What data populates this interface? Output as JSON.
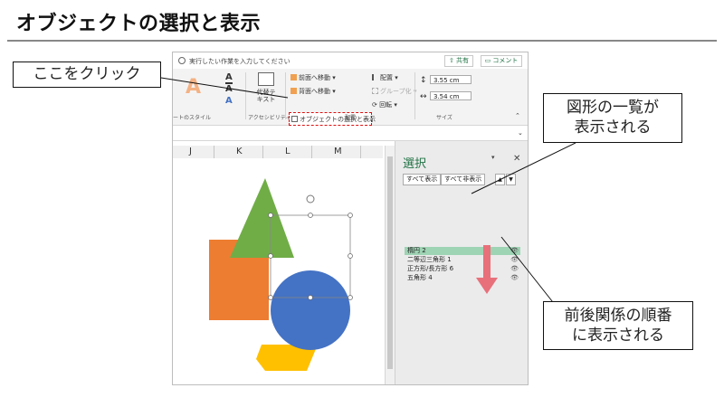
{
  "page": {
    "title": "オブジェクトの選択と表示"
  },
  "excel": {
    "tell_me": "実行したい作業を入力してください",
    "share": "共有",
    "comment": "コメント",
    "ribbon": {
      "wordart_styles_label": "ートのスタイル",
      "alt_text_label": "代替テ キスト",
      "accessibility_label": "アクセシビリティ",
      "arrange_label": "配置",
      "bring_forward": "前面へ移動",
      "send_backward": "背面へ移動",
      "selection_pane": "オブジェクトの選択と表示",
      "align": "配置",
      "group": "グループ化",
      "rotate": "回転",
      "size_label": "サイズ",
      "height": "3.55 cm",
      "width": "3.54 cm"
    },
    "columns": [
      "J",
      "K",
      "L",
      "M"
    ]
  },
  "pane": {
    "title": "選択",
    "show_all": "すべて表示",
    "hide_all": "すべて非表示",
    "objects": [
      {
        "name": "楕円 2",
        "selected": true
      },
      {
        "name": "二等辺三角形 1",
        "selected": false
      },
      {
        "name": "正方形/長方形 6",
        "selected": false
      },
      {
        "name": "五角形 4",
        "selected": false
      }
    ]
  },
  "callouts": {
    "click_here": "ここをクリック",
    "list_line1": "図形の一覧が",
    "list_line2": "表示される",
    "order_line1": "前後関係の順番",
    "order_line2": "に表示される"
  },
  "colors": {
    "highlight": "#d11",
    "selected_row": "#9ed3b4",
    "order_arrow": "#e8707a",
    "square": "#ed7d31",
    "triangle": "#70ad47",
    "circle": "#4472c4",
    "pentagon": "#ffc000"
  }
}
